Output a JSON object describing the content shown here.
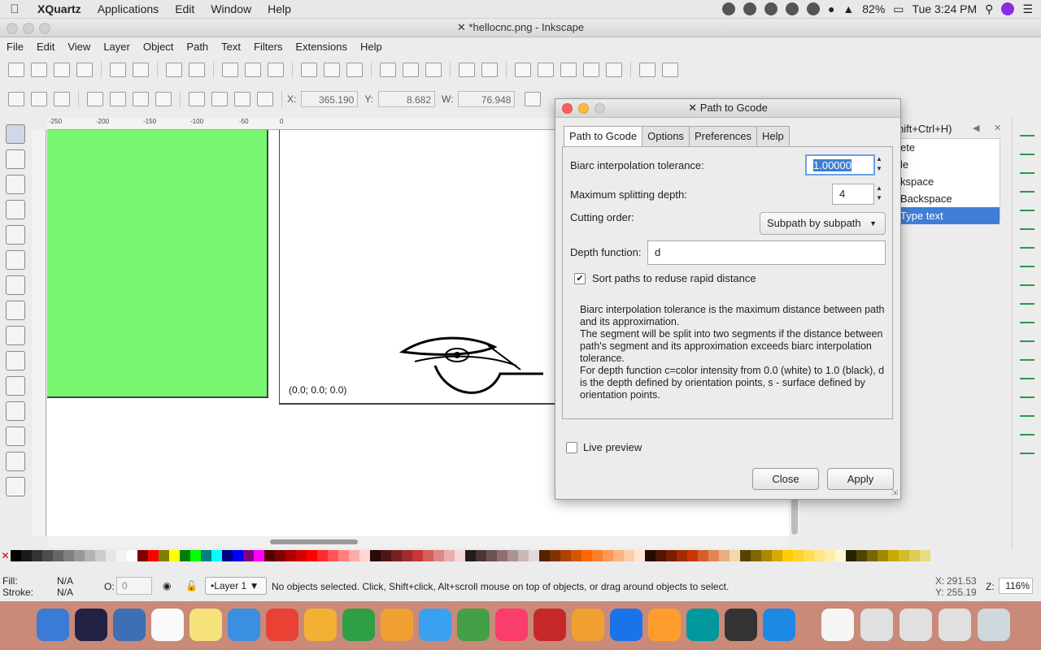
{
  "mac_menubar": {
    "apple_icon": "apple-icon",
    "items": [
      "XQuartz",
      "Applications",
      "Edit",
      "Window",
      "Help"
    ],
    "battery": "82%",
    "clock": "Tue 3:24 PM"
  },
  "window": {
    "title": "*hellocnc.png - Inkscape"
  },
  "ink_menu": [
    "File",
    "Edit",
    "View",
    "Layer",
    "Object",
    "Path",
    "Text",
    "Filters",
    "Extensions",
    "Help"
  ],
  "toolbar": {
    "x_label": "X:",
    "x_value": "365.190",
    "y_label": "Y:",
    "y_value": "8.682",
    "w_label": "W:",
    "w_value": "76.948"
  },
  "canvas": {
    "origin_label": "(0.0; 0.0; 0.0)"
  },
  "ruler_labels": [
    "-250",
    "-200",
    "-150",
    "-100",
    "-50",
    "0"
  ],
  "right_panel": {
    "shortcut_hint": "hift+Ctrl+H)",
    "items": [
      "ete",
      "le",
      "kspace",
      "Backspace",
      "Type text"
    ]
  },
  "dialog": {
    "title": "Path to Gcode",
    "tabs": [
      "Path to Gcode",
      "Options",
      "Preferences",
      "Help"
    ],
    "biarc_label": "Biarc interpolation tolerance:",
    "biarc_value": "1.00000",
    "split_label": "Maximum splitting depth:",
    "split_value": "4",
    "cutting_label": "Cutting order:",
    "cutting_value": "Subpath by subpath",
    "depth_label": "Depth function:",
    "depth_value": "d",
    "sort_label": "Sort paths to reduse rapid distance",
    "sort_checked": true,
    "description": "Biarc interpolation tolerance is the maximum distance between path and its approximation.\nThe segment will be split into two segments if the distance between path's segment and its approximation exceeds biarc interpolation tolerance.\nFor depth function c=color intensity from 0.0 (white) to 1.0 (black), d is the depth defined by orientation points, s - surface defined by orientation points.",
    "live_preview_label": "Live preview",
    "close_label": "Close",
    "apply_label": "Apply"
  },
  "statusbar": {
    "fill_label": "Fill:",
    "fill_value": "N/A",
    "stroke_label": "Stroke:",
    "stroke_value": "N/A",
    "opacity_label": "O:",
    "opacity_value": "0",
    "layer_value": "•Layer 1",
    "message": "No objects selected. Click, Shift+click, Alt+scroll mouse on top of objects, or drag around objects to select.",
    "x_label": "X:",
    "x_value": "291.53",
    "y_label": "Y:",
    "y_value": "255.19",
    "zoom_label": "Z:",
    "zoom_value": "116%"
  },
  "palette_colors": [
    "#000000",
    "#1a1a1a",
    "#333333",
    "#4d4d4d",
    "#666666",
    "#808080",
    "#999999",
    "#b3b3b3",
    "#cccccc",
    "#e6e6e6",
    "#f2f2f2",
    "#ffffff",
    "#800000",
    "#ff0000",
    "#808000",
    "#ffff00",
    "#008000",
    "#00ff00",
    "#008080",
    "#00ffff",
    "#000080",
    "#0000ff",
    "#800080",
    "#ff00ff",
    "#550000",
    "#800000",
    "#aa0000",
    "#d40000",
    "#ff0000",
    "#ff2a2a",
    "#ff5555",
    "#ff8080",
    "#ffaaaa",
    "#ffd5d5",
    "#280b0b",
    "#501616",
    "#782121",
    "#a02c2c",
    "#c83737",
    "#d35f5f",
    "#de8787",
    "#e9afaf",
    "#f4d7d7",
    "#241c1c",
    "#483737",
    "#6c5353",
    "#916f6f",
    "#ac9393",
    "#c8b7b7",
    "#e3dbdb",
    "#552200",
    "#803300",
    "#aa4400",
    "#d45500",
    "#ff6600",
    "#ff7f2a",
    "#ff9955",
    "#ffb380",
    "#ffccaa",
    "#ffe6d5",
    "#280b00",
    "#501600",
    "#782100",
    "#a02c00",
    "#c83700",
    "#d35f2a",
    "#de8755",
    "#e9af80",
    "#f4d7aa",
    "#554400",
    "#806600",
    "#aa8800",
    "#d4aa00",
    "#ffcc00",
    "#ffd42a",
    "#ffdd55",
    "#ffe680",
    "#ffeeaa",
    "#fff6d5",
    "#282200",
    "#504400",
    "#786600",
    "#a08800",
    "#c8aa00",
    "#d4bb2a",
    "#ddcc55",
    "#e6dd80"
  ],
  "dock_colors": [
    "#3a7bd5",
    "#222244",
    "#3d6fb5",
    "#fafafa",
    "#f5e27a",
    "#3b8fe0",
    "#e94235",
    "#f2b134",
    "#2ea043",
    "#f0a030",
    "#3aa1f0",
    "#43a047",
    "#fa3d6a",
    "#c62828",
    "#f0a030",
    "#1a73e8",
    "#ff9d2e",
    "#00979d",
    "#333333",
    "#1e88e5",
    "#f5f5f5",
    "#e0e0e0",
    "#e0e0e0",
    "#e0e0e0",
    "#cfd8dc"
  ]
}
